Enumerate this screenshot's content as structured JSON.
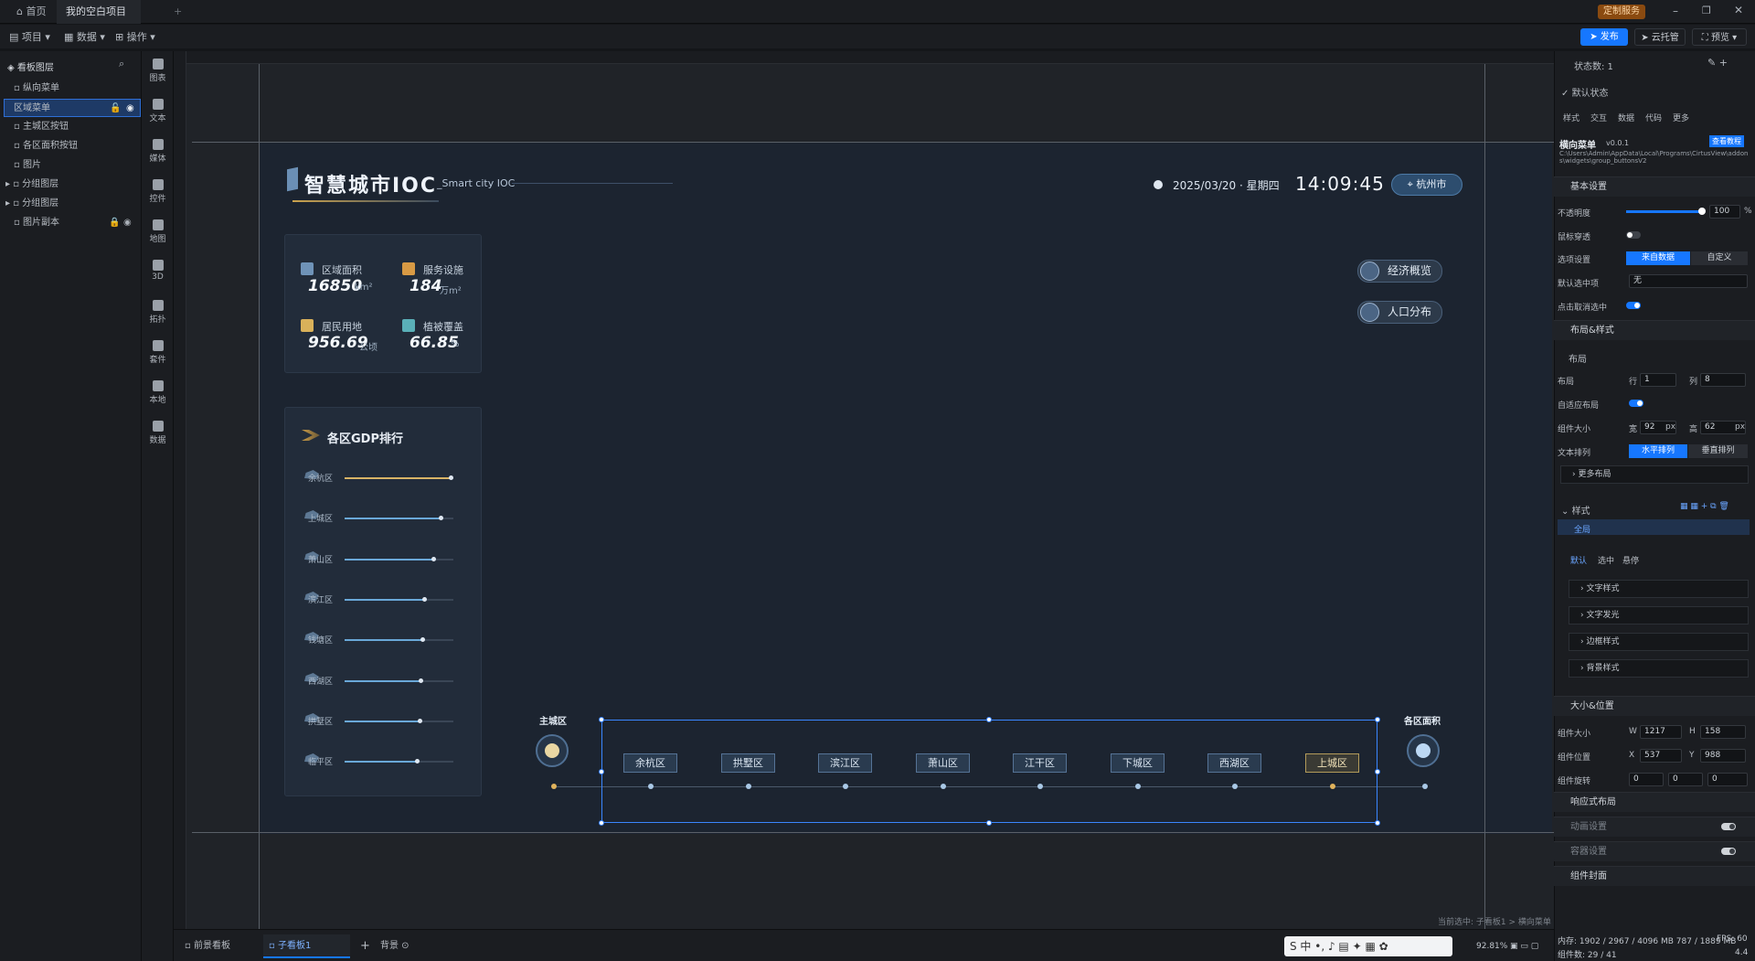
{
  "tabs": {
    "home": "首页",
    "project": "我的空白项目"
  },
  "topbar": {
    "custom_service": "定制服务"
  },
  "menubar": {
    "project": "项目",
    "data": "数据",
    "operate": "操作",
    "publish": "发布",
    "cloud": "云托管",
    "preview": "预览"
  },
  "layers": {
    "title": "看板图层",
    "items": [
      "纵向菜单",
      "区域菜单",
      "主城区按钮",
      "各区面积按钮",
      "图片",
      "分组图层",
      "分组图层",
      "图片副本"
    ]
  },
  "iconcol": [
    "图表",
    "文本",
    "媒体",
    "控件",
    "地图",
    "3D",
    "拓扑",
    "套件",
    "本地",
    "数据"
  ],
  "dashboard": {
    "title": "智慧城市IOC",
    "subtitle": "_Smart city IOC",
    "date": "2025/03/20 · 星期四",
    "time": "14:09:45",
    "city": "杭州市",
    "stats": [
      {
        "label": "区域面积",
        "value": "16850",
        "unit": "km²"
      },
      {
        "label": "服务设施",
        "value": "184",
        "unit": "万m²"
      },
      {
        "label": "居民用地",
        "value": "956.69",
        "unit": "公顷"
      },
      {
        "label": "植被覆盖",
        "value": "66.85",
        "unit": "%"
      }
    ],
    "gdp_title": "各区GDP排行",
    "gdp": [
      {
        "name": "余杭区",
        "value": 0.98
      },
      {
        "name": "上城区",
        "value": 0.89
      },
      {
        "name": "萧山区",
        "value": 0.82
      },
      {
        "name": "滨江区",
        "value": 0.74
      },
      {
        "name": "钱塘区",
        "value": 0.72
      },
      {
        "name": "西湖区",
        "value": 0.71
      },
      {
        "name": "拱墅区",
        "value": 0.7
      },
      {
        "name": "临平区",
        "value": 0.67
      }
    ],
    "side_buttons": [
      "经济概览",
      "人口分布"
    ],
    "left_end": "主城区",
    "right_end": "各区面积",
    "districts": [
      "余杭区",
      "拱墅区",
      "滨江区",
      "萧山区",
      "江干区",
      "下城区",
      "西湖区",
      "上城区"
    ],
    "selected_district": "上城区"
  },
  "rpanel": {
    "status_count": "状态数: 1",
    "default_state": "默认状态",
    "tabs": [
      "样式",
      "交互",
      "数据",
      "代码",
      "更多"
    ],
    "component": "横向菜单",
    "version": "v0.0.1",
    "tutorial": "查看教程",
    "path": "C:\\Users\\Admin\\AppData\\Local\\Programs\\CirtusView\\addons\\widgets\\group_buttonsV2",
    "basic": "基本设置",
    "opacity_label": "不透明度",
    "opacity_value": "100",
    "opacity_unit": "%",
    "mouse_through": "鼠标穿透",
    "option_setting": "选项设置",
    "from_data": "来自数据",
    "custom": "自定义",
    "default_selected": "默认选中项",
    "default_selected_value": "无",
    "click_cancel": "点击取消选中",
    "layout_style": "布局&样式",
    "layout": "布局",
    "layout_label": "布局",
    "row_label": "行",
    "row_value": "1",
    "col_label": "列",
    "col_value": "8",
    "adaptive": "自适应布局",
    "comp_size": "组件大小",
    "width_label": "宽",
    "width_value": "92",
    "height_label": "高",
    "height_value": "62",
    "px": "px",
    "text_arrange": "文本排列",
    "horizontal": "水平排列",
    "vertical": "垂直排列",
    "more_layout": "更多布局",
    "style": "样式",
    "global": "全局",
    "state_tabs": [
      "默认",
      "选中",
      "悬停"
    ],
    "style_items": [
      "文字样式",
      "文字发光",
      "边框样式",
      "背景样式"
    ],
    "size_pos": "大小&位置",
    "size_label": "组件大小",
    "w_label": "W",
    "w_value": "1217",
    "h_label": "H",
    "h_value": "158",
    "pos_label": "组件位置",
    "x_label": "X",
    "x_value": "537",
    "y_label": "Y",
    "y_value": "988",
    "rot_label": "组件旋转",
    "rot_x": "0",
    "rot_y": "0",
    "rot_z": "0",
    "deg": "°",
    "responsive": "响应式布局",
    "anim": "动画设置",
    "bg": "容器设置",
    "encap": "组件封面"
  },
  "bottom": {
    "tabs": [
      "前景看板",
      "子看板1",
      "背景"
    ],
    "selection": "当前选中: 子看板1 > 横向菜单",
    "zoom": "92.81%",
    "memory": "内存: 1902 / 2967 / 4096 MB 787 / 1889 MB",
    "count": "组件数: 29 / 41",
    "fps": "FPS: 60",
    "ver": "4.4"
  }
}
